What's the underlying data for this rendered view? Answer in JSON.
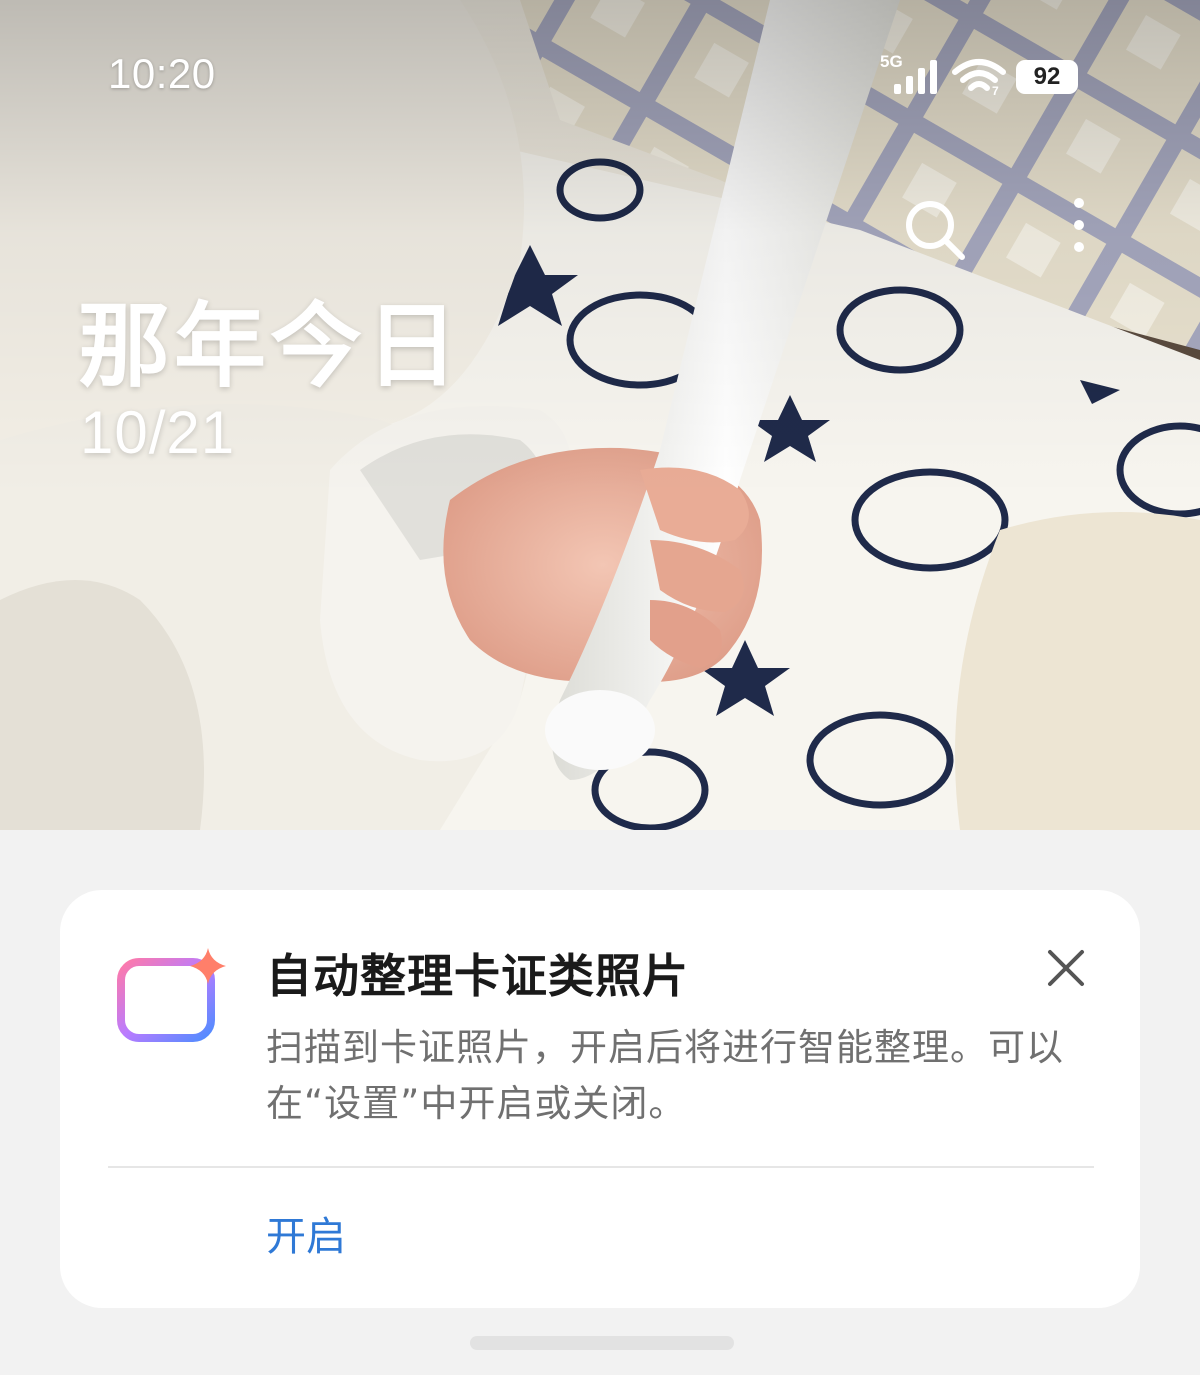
{
  "status_bar": {
    "time": "10:20",
    "network": "5G",
    "battery": "92",
    "wifi_icon": "wifi-icon",
    "signal_icon": "signal-icon"
  },
  "header": {
    "title": "那年今日",
    "date": "10/21",
    "actions": [
      "search-icon",
      "more-icon"
    ]
  },
  "card": {
    "icon": "card-sparkle-icon",
    "title": "自动整理卡证类照片",
    "description": "扫描到卡证照片，开启后将进行智能整理。可以在“设置”中开启或关闭。",
    "enable_label": "开启",
    "close_icon": "close-icon",
    "accent_color": "#2f79d6"
  }
}
